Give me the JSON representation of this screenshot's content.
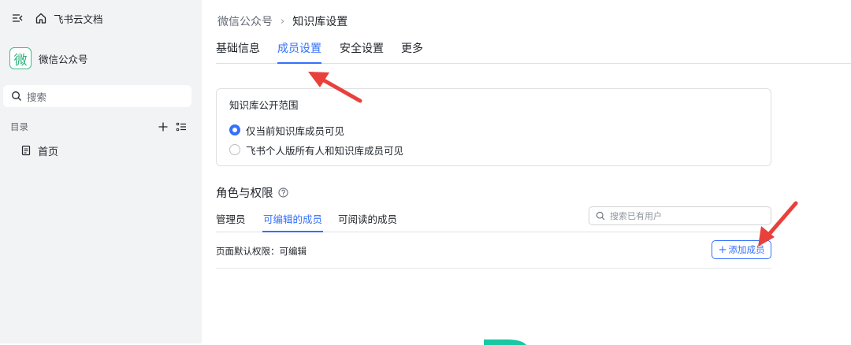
{
  "sidebar": {
    "workspace_label": "飞书云文档",
    "space_logo_char": "微",
    "space_name": "微信公众号",
    "search_placeholder": "搜索",
    "toc_title": "目录",
    "toc_items": [
      {
        "label": "首页",
        "icon": "doc-icon"
      }
    ]
  },
  "breadcrumb": {
    "parent": "微信公众号",
    "separator": "›",
    "current": "知识库设置"
  },
  "tabs": [
    {
      "label": "基础信息",
      "active": false
    },
    {
      "label": "成员设置",
      "active": true
    },
    {
      "label": "安全设置",
      "active": false
    },
    {
      "label": "更多",
      "active": false
    }
  ],
  "visibility": {
    "title": "知识库公开范围",
    "options": [
      {
        "label": "仅当前知识库成员可见",
        "selected": true
      },
      {
        "label": "飞书个人版所有人和知识库成员可见",
        "selected": false
      }
    ]
  },
  "roles": {
    "title": "角色与权限",
    "tabs": [
      {
        "label": "管理员",
        "active": false
      },
      {
        "label": "可编辑的成员",
        "active": true
      },
      {
        "label": "可阅读的成员",
        "active": false
      }
    ],
    "search_placeholder": "搜索已有用户",
    "default_permission": "页面默认权限：可编辑",
    "add_member_label": "添加成员"
  },
  "colors": {
    "accent": "#3370ff",
    "annotation_arrow": "#e8413c",
    "space_logo": "#2fb27c",
    "sidebar_bg": "#f2f3f5"
  }
}
